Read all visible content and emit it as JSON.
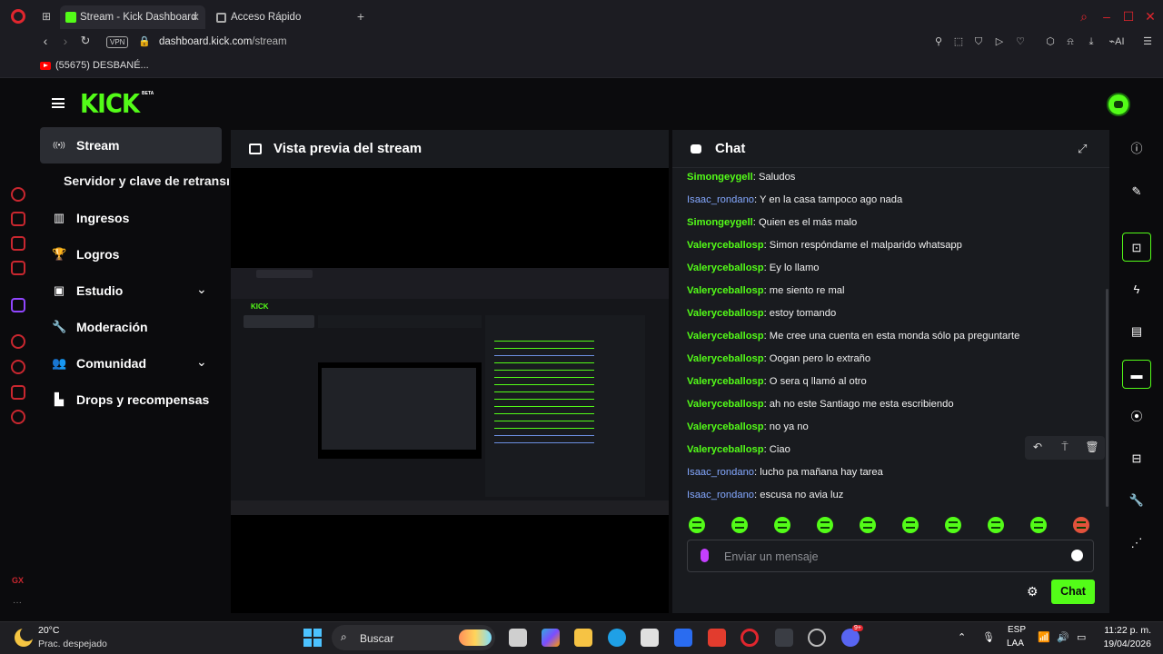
{
  "browser": {
    "tabs": [
      {
        "label": "Stream - Kick Dashboard",
        "active": true
      },
      {
        "label": "Acceso Rápido",
        "active": false
      }
    ],
    "url_host": "dashboard.kick.com",
    "url_path": "/stream",
    "vpn_label": "VPN",
    "bookmark": "(55675) DESBANÉ...",
    "ai_label": "AI",
    "accent": "#e0262e"
  },
  "kick": {
    "logo": "KICK",
    "beta": "BETA",
    "brand_color": "#53fc18"
  },
  "nav": {
    "items": [
      {
        "label": "Stream",
        "icon": "broadcast-icon",
        "glyph": "((•))"
      },
      {
        "label": "Ingresos",
        "icon": "chart-icon",
        "glyph": "▥"
      },
      {
        "label": "Logros",
        "icon": "trophy-icon",
        "glyph": "🏆"
      },
      {
        "label": "Estudio",
        "icon": "studio-icon",
        "glyph": "▣"
      },
      {
        "label": "Moderación",
        "icon": "wrench-icon",
        "glyph": "🔧"
      },
      {
        "label": "Comunidad",
        "icon": "community-icon",
        "glyph": "👥"
      },
      {
        "label": "Drops y recompensas",
        "icon": "drops-icon",
        "glyph": "▙"
      }
    ],
    "sub_item": "Servidor y clave de retransmisión"
  },
  "preview": {
    "title": "Vista previa del stream"
  },
  "chat": {
    "title": "Chat",
    "messages": [
      {
        "user": "Simongeygell",
        "color": "g",
        "text": "Saludos"
      },
      {
        "user": "Isaac_rondano",
        "color": "b",
        "text": "Y en la casa tampoco ago nada"
      },
      {
        "user": "Simongeygell",
        "color": "g",
        "text": "Quien es el más malo"
      },
      {
        "user": "Valeryceballosp",
        "color": "g",
        "text": "Simon respóndame el malparido whatsapp"
      },
      {
        "user": "Valeryceballosp",
        "color": "g",
        "text": "Ey lo llamo"
      },
      {
        "user": "Valeryceballosp",
        "color": "g",
        "text": "me siento re mal"
      },
      {
        "user": "Valeryceballosp",
        "color": "g",
        "text": "estoy tomando"
      },
      {
        "user": "Valeryceballosp",
        "color": "g",
        "text": "Me cree una cuenta en esta monda sólo pa preguntarte"
      },
      {
        "user": "Valeryceballosp",
        "color": "g",
        "text": "Oogan pero lo extraño"
      },
      {
        "user": "Valeryceballosp",
        "color": "g",
        "text": "O sera q llamó al otro"
      },
      {
        "user": "Valeryceballosp",
        "color": "g",
        "text": "ah no este Santiago me esta escribiendo"
      },
      {
        "user": "Valeryceballosp",
        "color": "g",
        "text": "no ya no"
      },
      {
        "user": "Valeryceballosp",
        "color": "g",
        "text": "Ciao"
      },
      {
        "user": "Isaac_rondano",
        "color": "b",
        "text": "lucho pa mañana hay tarea"
      },
      {
        "user": "Isaac_rondano",
        "color": "b",
        "text": "escusa no avia luz"
      }
    ],
    "input_placeholder": "Enviar un mensaje",
    "send_label": "Chat"
  },
  "taskbar": {
    "temperature": "20°C",
    "weather": "Prac. despejado",
    "search_label": "Buscar",
    "lang_top": "ESP",
    "lang_bottom": "LAA",
    "time": "11:22 p. m.",
    "date": "19/04/2026",
    "discord_badge": "9+"
  }
}
